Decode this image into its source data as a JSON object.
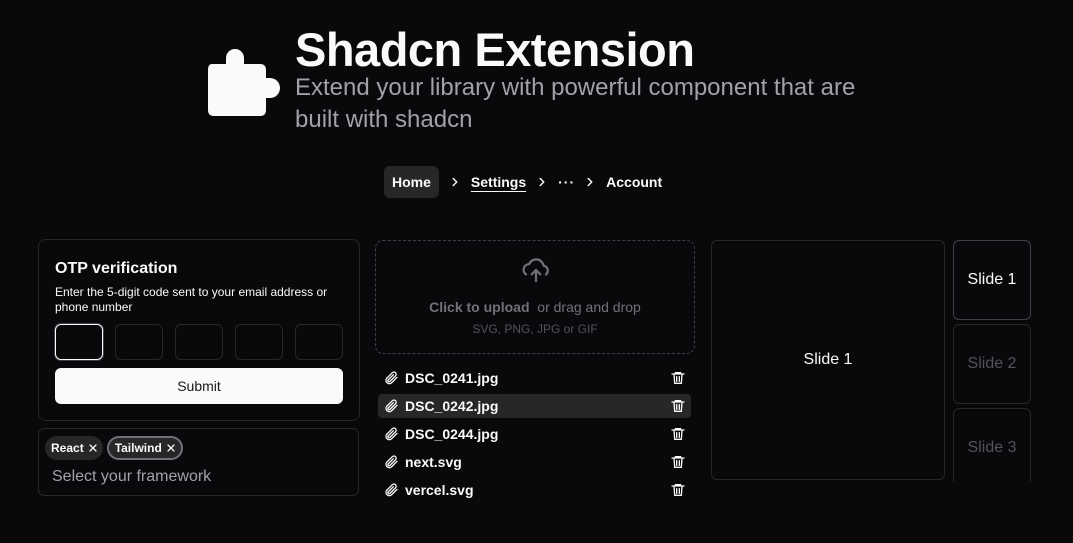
{
  "hero": {
    "title": "Shadcn Extension",
    "subtitle": "Extend your library with powerful component that are built with shadcn",
    "logo_icon": "puzzle-piece-icon"
  },
  "breadcrumb": {
    "items": [
      "Home",
      "Settings",
      "···",
      "Account"
    ]
  },
  "otp": {
    "title": "OTP verification",
    "description": "Enter the 5-digit code sent to your email address or phone number",
    "slots": [
      "",
      "",
      "",
      "",
      ""
    ],
    "submit_label": "Submit"
  },
  "multiselect": {
    "chips": [
      "React",
      "Tailwind"
    ],
    "placeholder": "Select your framework"
  },
  "upload": {
    "cta": "Click to upload",
    "secondary": "or drag and drop",
    "hint": "SVG, PNG, JPG or GIF",
    "files": [
      "DSC_0241.jpg",
      "DSC_0242.jpg",
      "DSC_0244.jpg",
      "next.svg",
      "vercel.svg"
    ],
    "selected_index": 1
  },
  "carousel": {
    "main": "Slide 1",
    "thumbnails": [
      "Slide 1",
      "Slide 2",
      "Slide 3"
    ]
  },
  "colors": {
    "background": "#09090b",
    "foreground": "#fafafa",
    "muted": "#a1a1aa",
    "border": "#27272a"
  }
}
